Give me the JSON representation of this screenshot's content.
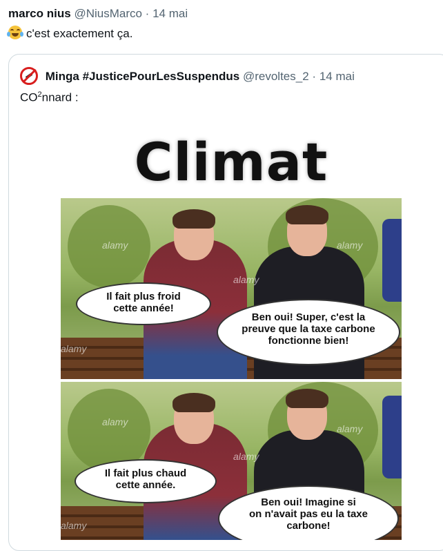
{
  "tweet": {
    "author_name": "marco nius",
    "author_handle": "@NiusMarco",
    "separator": "·",
    "date": "14 mai",
    "emoji": "joy-tears-emoji",
    "text": "c'est exactement ça."
  },
  "quoted": {
    "avatar_icon": "no-syringe-icon",
    "author_name": "Minga #JusticePourLesSuspendus",
    "author_handle": "@revoltes_2",
    "separator": "·",
    "date": "14 mai",
    "text_prefix": "CO",
    "text_sup": "2",
    "text_suffix": "nnard :"
  },
  "meme": {
    "title": "Climat",
    "watermark": "alamy",
    "panel1": {
      "left_bubble": [
        "Il fait plus froid",
        "cette année!"
      ],
      "right_bubble": [
        "Ben oui! Super, c'est la",
        "preuve que la taxe carbone",
        "fonctionne bien!"
      ]
    },
    "panel2": {
      "left_bubble": [
        "Il fait plus chaud",
        "cette année."
      ],
      "right_bubble": [
        "Ben oui! Imagine si",
        "on n'avait pas eu la taxe",
        "carbone!"
      ]
    }
  },
  "colors": {
    "muted": "#536471",
    "border": "#cfd9de",
    "avatar_red": "#d81e1e"
  }
}
